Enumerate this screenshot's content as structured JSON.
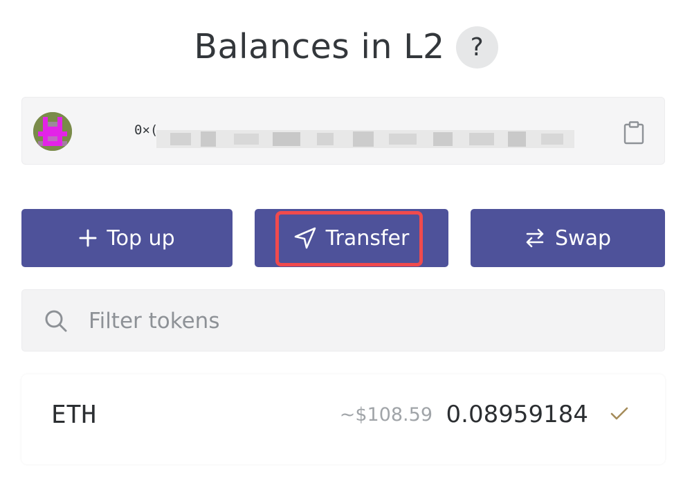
{
  "header": {
    "title": "Balances in L2",
    "help_label": "?"
  },
  "account": {
    "address_prefix": "0×(",
    "avatar_colors": [
      "#7a8b4a",
      "#e323e7"
    ],
    "copy_icon": "clipboard-icon"
  },
  "actions": {
    "top_up": {
      "label": "Top up",
      "icon": "plus-icon"
    },
    "transfer": {
      "label": "Transfer",
      "icon": "send-icon"
    },
    "swap": {
      "label": "Swap",
      "icon": "swap-arrows-icon"
    }
  },
  "filter": {
    "placeholder": "Filter tokens",
    "value": "",
    "icon": "search-icon"
  },
  "tokens": [
    {
      "symbol": "ETH",
      "usd_value": "~$108.59",
      "amount": "0.08959184",
      "status_icon": "check-icon"
    }
  ],
  "colors": {
    "button_bg": "#4e529a",
    "highlight": "#f04a4d",
    "check": "#a58c5a"
  }
}
